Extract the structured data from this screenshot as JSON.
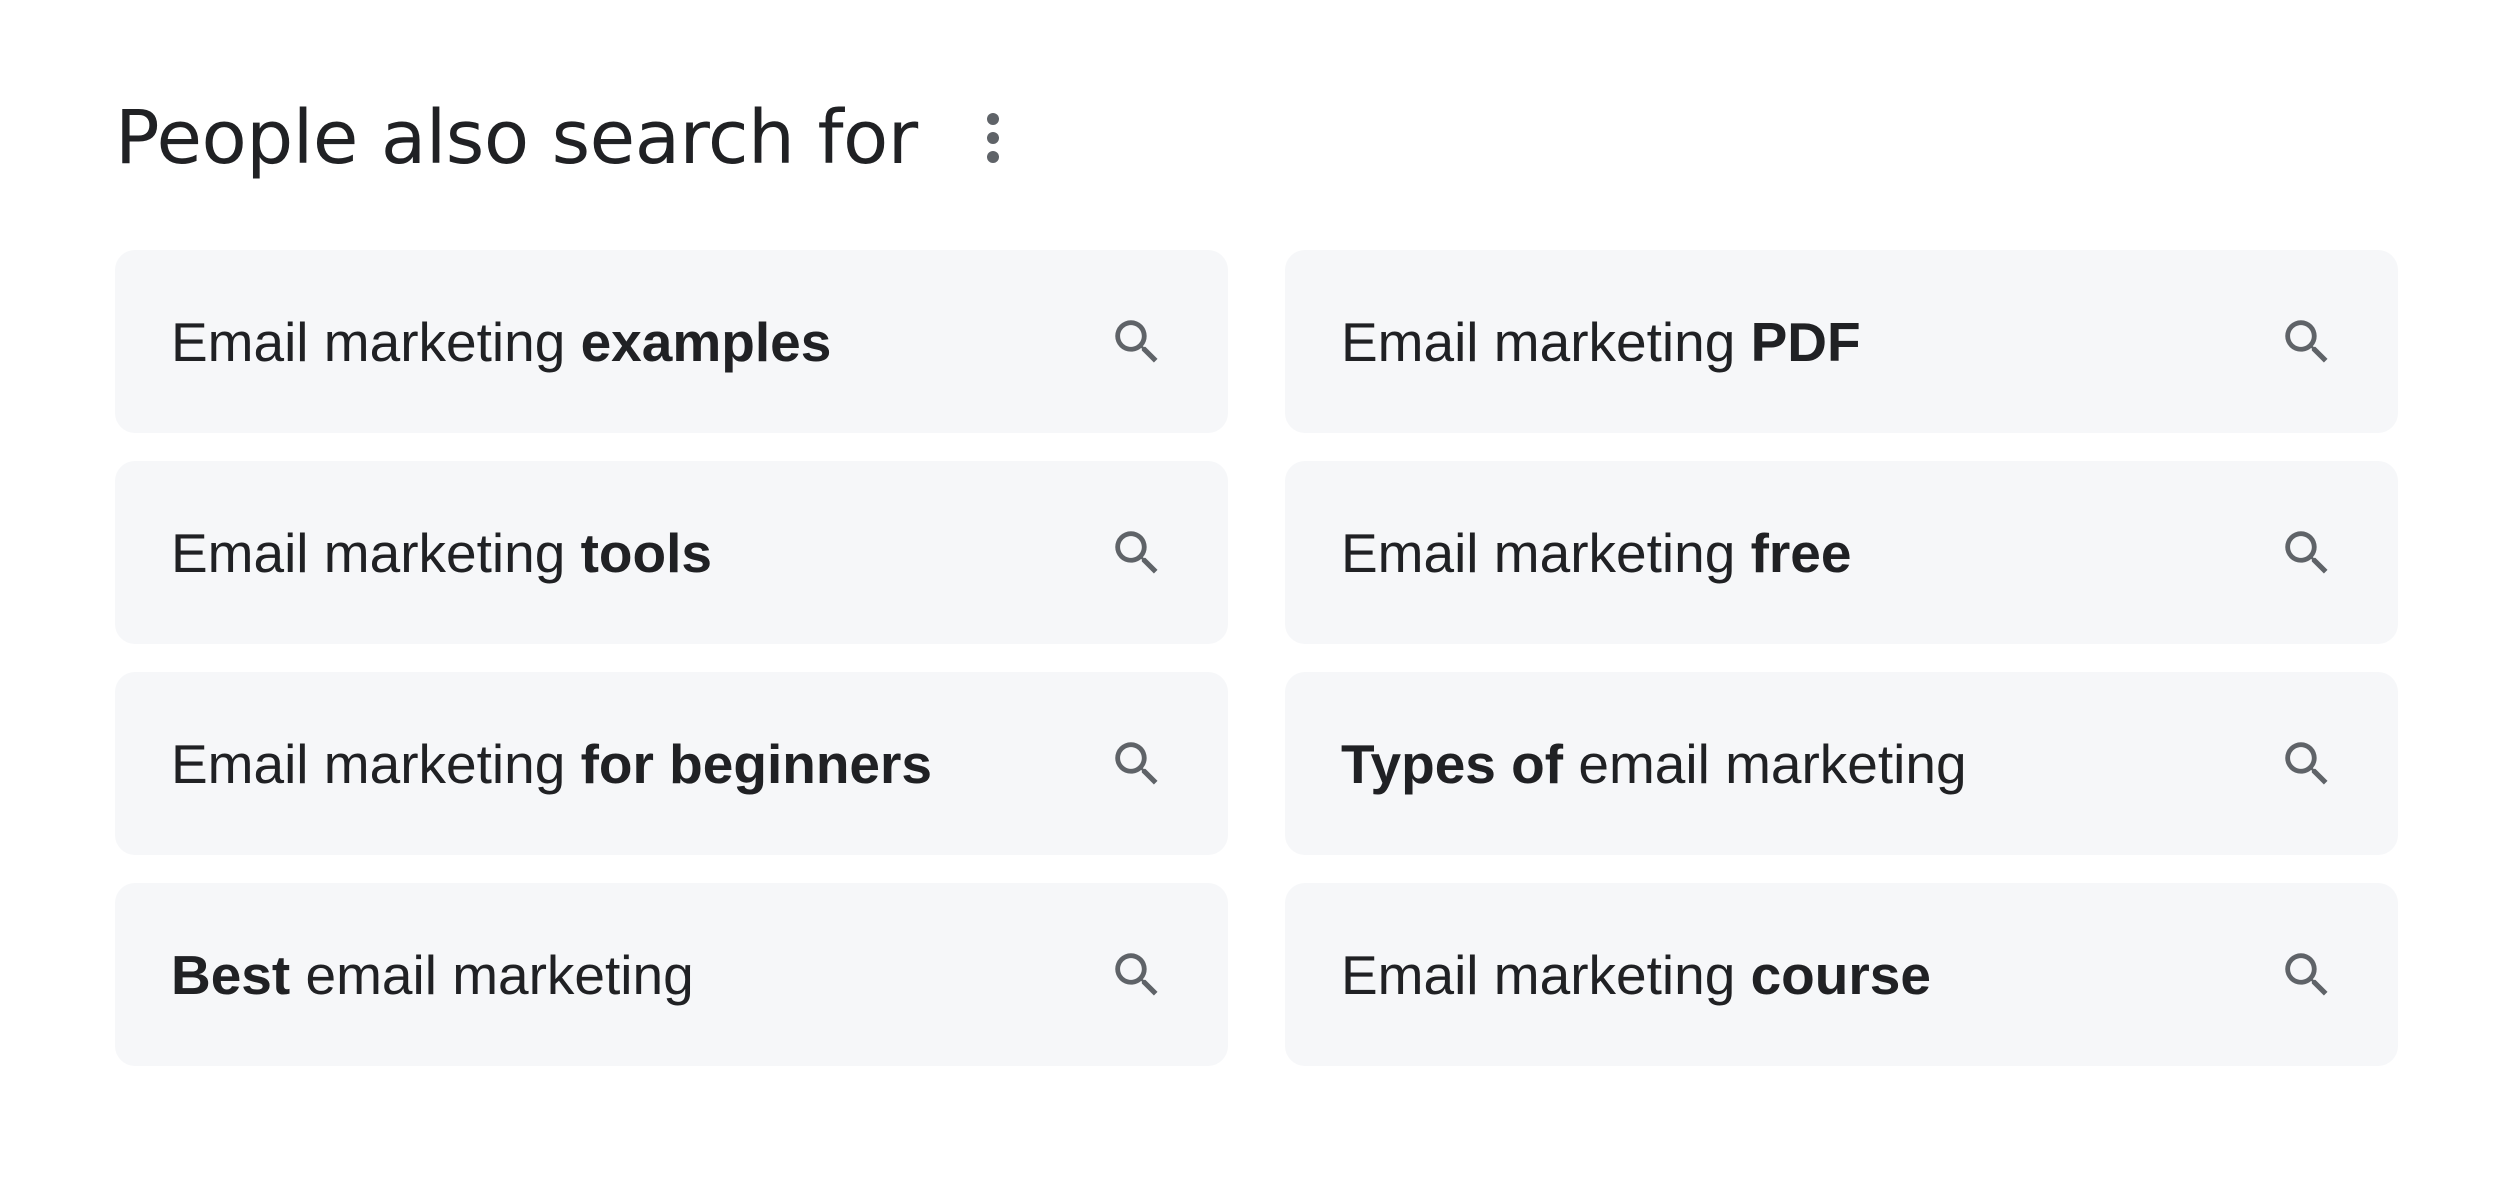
{
  "header": {
    "title": "People also search for",
    "more_icon": "more-vert-icon"
  },
  "suggestions": [
    {
      "before": "Email marketing ",
      "bold": "examples",
      "after": ""
    },
    {
      "before": "Email marketing ",
      "bold": "PDF",
      "after": ""
    },
    {
      "before": "Email marketing ",
      "bold": "tools",
      "after": ""
    },
    {
      "before": "Email marketing ",
      "bold": "free",
      "after": ""
    },
    {
      "before": "Email marketing ",
      "bold": "for beginners",
      "after": ""
    },
    {
      "before": "",
      "bold": "Types of",
      "after": " email marketing"
    },
    {
      "before": "",
      "bold": "Best",
      "after": " email marketing"
    },
    {
      "before": "Email marketing ",
      "bold": "course",
      "after": ""
    }
  ],
  "icons": {
    "search": "search-icon"
  },
  "colors": {
    "chip_background": "#f6f7f9",
    "text": "#202124",
    "icon": "#5f6368"
  }
}
